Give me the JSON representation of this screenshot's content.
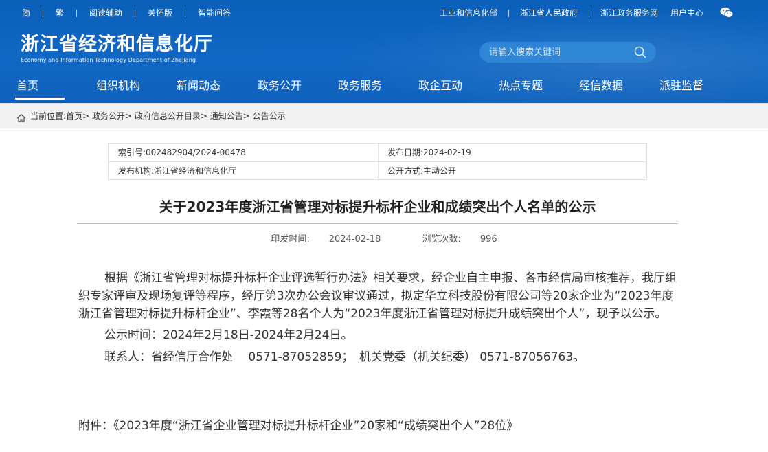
{
  "topbar": {
    "left_links": [
      "简",
      "繁",
      "阅读辅助",
      "关怀版",
      "智能问答"
    ],
    "right_links": [
      "工业和信息化部",
      "浙江省人民政府",
      "浙江政务服务网",
      "用户中心"
    ],
    "wechat_icon": "wechat-icon"
  },
  "logo": {
    "cn": "浙江省经济和信息化厅",
    "en": "Economy and Information Technology Department of Zhejiang"
  },
  "search": {
    "placeholder": "请输入搜索关键词"
  },
  "nav": {
    "items": [
      "首页",
      "组织机构",
      "新闻动态",
      "政务公开",
      "政务服务",
      "政企互动",
      "热点专题",
      "经信数据",
      "派驻监督"
    ],
    "active": "首页"
  },
  "breadcrumb": {
    "prefix": "当前位置:",
    "items": [
      "首页",
      "政务公开",
      "政府信息公开目录",
      "通知公告",
      "公告公示"
    ]
  },
  "meta": {
    "index_label": "索引号:",
    "index_value": "002482904/2024-00478",
    "date_label": "发布日期:",
    "date_value": "2024-02-19",
    "org_label": "发布机构:",
    "org_value": "浙江省经济和信息化厅",
    "mode_label": "公开方式:",
    "mode_value": "主动公开"
  },
  "article": {
    "title": "关于2023年度浙江省管理对标提升标杆企业和成绩突出个人名单的公示",
    "print_time_label": "印发时间:",
    "print_time": "2024-02-18",
    "views_label": "浏览次数:",
    "views": "996",
    "paragraph1": "根据《浙江省管理对标提升标杆企业评选暂行办法》相关要求，经企业自主申报、各市经信局审核推荐，我厅组织专家评审及现场复评等程序，经厅第3次办公会议审议通过，拟定华立科技股份有限公司等20家企业为“2023年度浙江省管理对标提升标杆企业”、李霞等28名个人为“2023年度浙江省管理对标提升成绩突出个人”，现予以公示。",
    "paragraph2": "公示时间：2024年2月18日-2024年2月24日。",
    "paragraph3": "联系人：省经信厅合作处　 0571-87052859；　机关党委（机关纪委） 0571-87056763。",
    "attachment": "附件：《2023年度“浙江省企业管理对标提升标杆企业”20家和“成绩突出个人”28位》"
  }
}
